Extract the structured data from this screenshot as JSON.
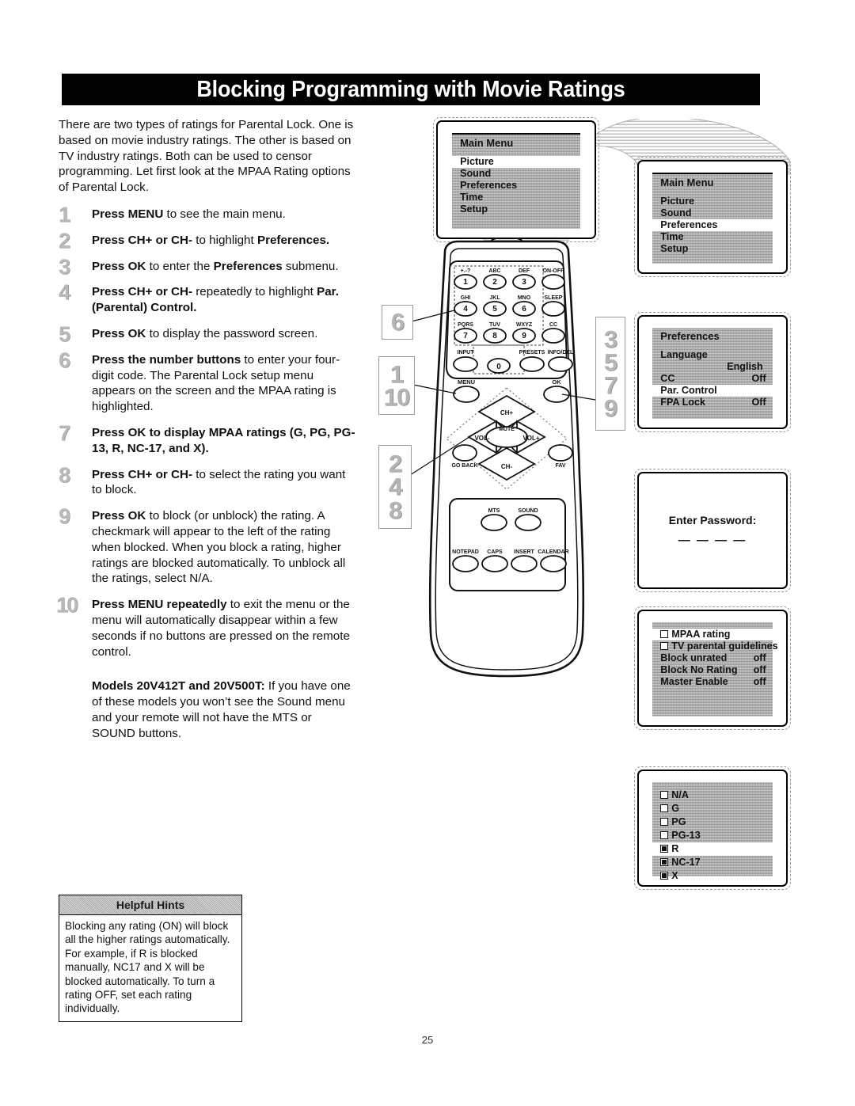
{
  "page": {
    "title": "Blocking Programming with Movie Ratings",
    "number": "25"
  },
  "intro": {
    "paragraph": "There are two types of ratings for Parental Lock. One is based on movie industry ratings. The other is based on TV industry ratings. Both can be used to censor programming. Let first look at the MPAA Rating options of Parental Lock."
  },
  "steps": [
    {
      "num": "1",
      "html": "<b>Press MENU</b> to see the main menu."
    },
    {
      "num": "2",
      "html": "<b>Press CH+ or CH-</b> to highlight <b>Preferences.</b>"
    },
    {
      "num": "3",
      "html": "<b>Press OK</b> to enter the <b>Preferences</b> submenu."
    },
    {
      "num": "4",
      "html": "<b>Press CH+ or CH-</b> repeatedly to highlight <b>Par. (Parental) Control.</b>"
    },
    {
      "num": "5",
      "html": "<b>Press OK</b> to display the password screen."
    },
    {
      "num": "6",
      "html": "<b>Press the number buttons</b> to enter your four-digit code. The Parental Lock setup menu appears on the screen and the MPAA rating is highlighted."
    },
    {
      "num": "7",
      "html": "<b>Press OK to display MPAA ratings (G, PG, PG-13, R, NC-17, and X).</b>"
    },
    {
      "num": "8",
      "html": "<b>Press CH+ or CH-</b> to select the rating you want to block."
    },
    {
      "num": "9",
      "html": "<b>Press OK</b> to block (or unblock) the rating. A checkmark will appear to the left of the rating when blocked. When you block a rating, higher ratings are blocked automatically. To unblock all the ratings, select N/A."
    },
    {
      "num": "10",
      "html": "<b>Press MENU repeatedly</b> to exit the menu or the menu will automatically disappear within a few seconds if no buttons are pressed on the remote control."
    }
  ],
  "models_note": "<b>Models 20V412T and 20V500T:</b> If you have one of these models you won&rsquo;t see the Sound menu and your remote will not have the MTS or SOUND buttons.",
  "hints": {
    "heading": "Helpful Hints",
    "body": "Blocking any rating (ON) will block all the higher ratings automatically. For example, if R is blocked manually, NC17 and X will be blocked automatically. To turn a rating OFF, set each rating individually."
  },
  "screens": {
    "main_menu_1": {
      "title": "Main Menu",
      "items": [
        {
          "label": "Picture",
          "highlighted": true
        },
        {
          "label": "Sound",
          "highlighted": false
        },
        {
          "label": "Preferences",
          "highlighted": false
        },
        {
          "label": "Time",
          "highlighted": false
        },
        {
          "label": "Setup",
          "highlighted": false
        }
      ]
    },
    "main_menu_2": {
      "title": "Main Menu",
      "items": [
        {
          "label": "Picture",
          "highlighted": false
        },
        {
          "label": "Sound",
          "highlighted": false
        },
        {
          "label": "Preferences",
          "highlighted": true
        },
        {
          "label": "Time",
          "highlighted": false
        },
        {
          "label": "Setup",
          "highlighted": false
        }
      ]
    },
    "preferences": {
      "title": "Preferences",
      "rows": [
        {
          "label": "Language",
          "value": "",
          "highlighted": false
        },
        {
          "label": "",
          "value": "English",
          "highlighted": false
        },
        {
          "label": "CC",
          "value": "Off",
          "highlighted": false
        },
        {
          "label": "Par. Control",
          "value": "",
          "highlighted": true
        },
        {
          "label": "FPA Lock",
          "value": "Off",
          "highlighted": false
        }
      ]
    },
    "password": {
      "label": "Enter Password:",
      "dashes": "— — — —"
    },
    "parental_setup": {
      "rows": [
        {
          "label": "MPAA rating",
          "value": "",
          "checkbox": true,
          "checked": false,
          "highlighted": true
        },
        {
          "label": "TV parental guidelines",
          "value": "",
          "checkbox": true,
          "checked": false,
          "highlighted": false
        },
        {
          "label": "Block unrated",
          "value": "off",
          "checkbox": false,
          "checked": false,
          "highlighted": false
        },
        {
          "label": "Block No Rating",
          "value": "off",
          "checkbox": false,
          "checked": false,
          "highlighted": false
        },
        {
          "label": "Master Enable",
          "value": "off",
          "checkbox": false,
          "checked": false,
          "highlighted": false
        }
      ]
    },
    "mpaa_ratings": {
      "rows": [
        {
          "label": "N/A",
          "checked": false,
          "highlighted": false
        },
        {
          "label": "G",
          "checked": false,
          "highlighted": false
        },
        {
          "label": "PG",
          "checked": false,
          "highlighted": false
        },
        {
          "label": "PG-13",
          "checked": false,
          "highlighted": false
        },
        {
          "label": "R",
          "checked": true,
          "highlighted": true
        },
        {
          "label": "NC-17",
          "checked": true,
          "highlighted": false
        },
        {
          "label": "X",
          "checked": true,
          "highlighted": false
        }
      ]
    }
  },
  "remote": {
    "keypad": [
      {
        "top": "+.-?",
        "key": "1"
      },
      {
        "top": "ABC",
        "key": "2"
      },
      {
        "top": "DEF",
        "key": "3"
      },
      {
        "top": "ON-OFF",
        "key": ""
      },
      {
        "top": "GHI",
        "key": "4"
      },
      {
        "top": "JKL",
        "key": "5"
      },
      {
        "top": "MNO",
        "key": "6"
      },
      {
        "top": "SLEEP",
        "key": ""
      },
      {
        "top": "PQRS",
        "key": "7"
      },
      {
        "top": "TUV",
        "key": "8"
      },
      {
        "top": "WXYZ",
        "key": "9"
      },
      {
        "top": "CC",
        "key": ""
      }
    ],
    "row4": [
      {
        "top": "INPUT",
        "key": ""
      },
      {
        "top": "",
        "key": "0"
      },
      {
        "top": "PRESETS",
        "key": ""
      },
      {
        "top": "INFO/DEL",
        "key": ""
      }
    ],
    "menu_label": "MENU",
    "ok_label": "OK",
    "dpad": {
      "up": "CH+",
      "down": "CH-",
      "left": "VOL-",
      "right": "VOL+",
      "center": "MUTE"
    },
    "go_back_label": "GO BACK",
    "fav_label": "FAV",
    "audio_buttons": [
      "MTS",
      "SOUND"
    ],
    "bottom_buttons": [
      "NOTEPAD",
      "CAPS",
      "INSERT",
      "CALENDAR"
    ],
    "callouts": {
      "number_buttons": [
        "6"
      ],
      "menu_button": [
        "1",
        "10"
      ],
      "dpad_button": [
        "2",
        "4",
        "8"
      ],
      "ok_button": [
        "3",
        "5",
        "7",
        "9"
      ]
    }
  }
}
